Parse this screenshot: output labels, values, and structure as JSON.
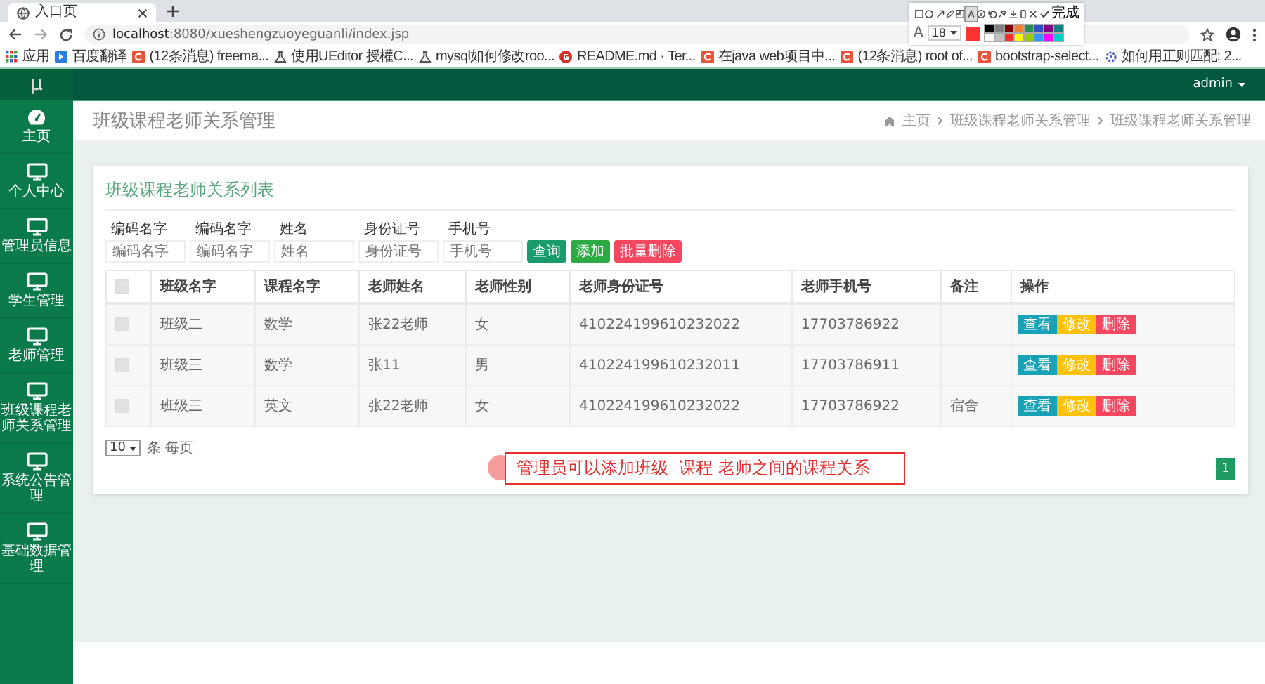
{
  "browser": {
    "tab": {
      "title": "入口页"
    },
    "url": {
      "host": "localhost",
      "path": ":8080/xueshengzuoyeguanli/index.jsp"
    },
    "bookmarks": [
      {
        "label": "应用",
        "kind": "apps"
      },
      {
        "label": "百度翻译",
        "kind": "blue"
      },
      {
        "label": "(12条消息) freema...",
        "kind": "red"
      },
      {
        "label": "使用UEditor 授權C...",
        "kind": "glyph"
      },
      {
        "label": "mysql如何修改roo...",
        "kind": "glyph"
      },
      {
        "label": "README.md · Ter...",
        "kind": "circle"
      },
      {
        "label": "在java web项目中...",
        "kind": "red"
      },
      {
        "label": "(12条消息) root of...",
        "kind": "red"
      },
      {
        "label": "bootstrap-select...",
        "kind": "red"
      },
      {
        "label": "如何用正则匹配: 2...",
        "kind": "gear"
      }
    ]
  },
  "annotation_toolbar": {
    "tools": [
      {
        "kind": "rect",
        "selected": false
      },
      {
        "kind": "circle",
        "selected": false
      },
      {
        "kind": "arrow",
        "selected": false
      },
      {
        "kind": "pencil",
        "selected": false
      },
      {
        "kind": "mosaic",
        "selected": false
      },
      {
        "kind": "text",
        "selected": true
      },
      {
        "kind": "number",
        "selected": false
      },
      {
        "kind": "undo",
        "selected": false
      },
      {
        "kind": "pin",
        "selected": false
      },
      {
        "kind": "download",
        "selected": false
      },
      {
        "kind": "phone",
        "selected": false
      },
      {
        "kind": "close",
        "selected": false
      }
    ],
    "done": "完成",
    "size_label": "A",
    "font_size": "18",
    "current_swatch": {
      "color": "#ff3333"
    },
    "palette": [
      {
        "color": "#000000"
      },
      {
        "color": "#808080"
      },
      {
        "color": "#800000"
      },
      {
        "color": "#f08030"
      },
      {
        "color": "#2e8b57"
      },
      {
        "color": "#3050c0"
      },
      {
        "color": "#800080"
      },
      {
        "color": "#108080"
      },
      {
        "color": "#ffffff"
      },
      {
        "color": "#c0c0c0"
      },
      {
        "color": "#ff3030"
      },
      {
        "color": "#ffff00"
      },
      {
        "color": "#99cc00"
      },
      {
        "color": "#3399ff"
      },
      {
        "color": "#ff00ff"
      },
      {
        "color": "#00cccc"
      }
    ]
  },
  "header": {
    "user": "admin"
  },
  "sidebar": {
    "logo": "μ",
    "items": [
      {
        "label": "主页",
        "kind": "dashboard"
      },
      {
        "label": "个人中心",
        "kind": "monitor"
      },
      {
        "label": "管理员信息",
        "kind": "monitor"
      },
      {
        "label": "学生管理",
        "kind": "monitor"
      },
      {
        "label": "老师管理",
        "kind": "monitor"
      },
      {
        "label": "班级课程老师关系管理",
        "kind": "monitor"
      },
      {
        "label": "系统公告管理",
        "kind": "monitor"
      },
      {
        "label": "基础数据管理",
        "kind": "monitor"
      }
    ]
  },
  "page": {
    "title": "班级课程老师关系管理",
    "breadcrumb": [
      "主页",
      "班级课程老师关系管理",
      "班级课程老师关系管理"
    ]
  },
  "card": {
    "title": "班级课程老师关系列表",
    "filters": [
      {
        "label": "编码名字",
        "placeholder": "编码名字"
      },
      {
        "label": "编码名字",
        "placeholder": "编码名字"
      },
      {
        "label": "姓名",
        "placeholder": "姓名"
      },
      {
        "label": "身份证号",
        "placeholder": "身份证号"
      },
      {
        "label": "手机号",
        "placeholder": "手机号"
      }
    ],
    "buttons": [
      {
        "label": "查询",
        "kind": "search"
      },
      {
        "label": "添加",
        "kind": "add"
      },
      {
        "label": "批量删除",
        "kind": "delete"
      }
    ],
    "table": {
      "header_checked": false,
      "columns": [
        "班级名字",
        "课程名字",
        "老师姓名",
        "老师性别",
        "老师身份证号",
        "老师手机号",
        "备注",
        "操作"
      ],
      "rows": [
        {
          "checked": false,
          "cells": [
            "班级二",
            "数学",
            "张22老师",
            "女",
            "410224199610232022",
            "17703786922"
          ],
          "actions": [
            {
              "label": "查看",
              "kind": "view"
            },
            {
              "label": "修改",
              "kind": "edit"
            },
            {
              "label": "删除",
              "kind": "delete"
            }
          ]
        },
        {
          "checked": false,
          "cells": [
            "班级三",
            "数学",
            "张11",
            "男",
            "410224199610232011",
            "17703786911"
          ],
          "actions": [
            {
              "label": "查看",
              "kind": "view"
            },
            {
              "label": "修改",
              "kind": "edit"
            },
            {
              "label": "删除",
              "kind": "delete"
            }
          ]
        },
        {
          "checked": false,
          "cells": [
            "班级三",
            "英文",
            "张22老师",
            "女",
            "410224199610232022",
            "17703786922"
          ],
          "remark": "宿舍",
          "actions": [
            {
              "label": "查看",
              "kind": "view"
            },
            {
              "label": "修改",
              "kind": "edit"
            },
            {
              "label": "删除",
              "kind": "delete"
            }
          ]
        }
      ]
    },
    "page_size": "10",
    "per_page_label": "条 每页",
    "pages": [
      {
        "label": "1",
        "selected": true
      }
    ],
    "annotation": {
      "text": "管理员可以添加班级  课程 老师之间的课程关系"
    }
  }
}
